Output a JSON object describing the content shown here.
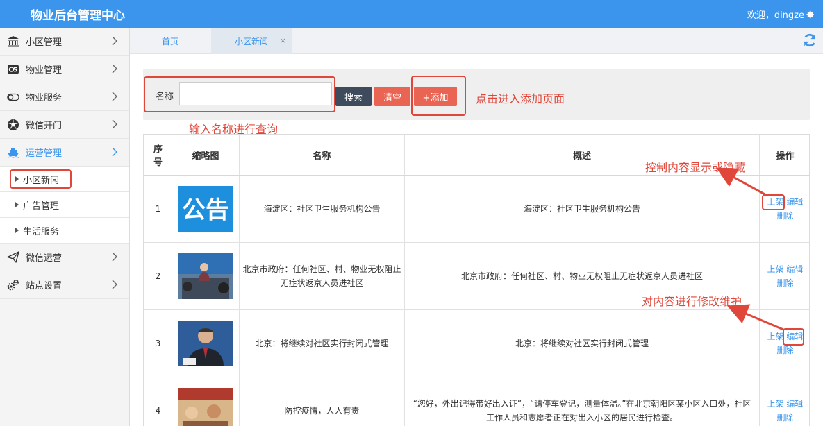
{
  "header": {
    "title": "物业后台管理中心",
    "welcome": "欢迎，dingze"
  },
  "sidebar": {
    "items": [
      {
        "label": "小区管理",
        "icon": "building-icon"
      },
      {
        "label": "物业管理",
        "icon": "os-badge-icon"
      },
      {
        "label": "物业服务",
        "icon": "toggle-icon"
      },
      {
        "label": "微信开门",
        "icon": "football-icon"
      },
      {
        "label": "运营管理",
        "icon": "ship-icon"
      }
    ],
    "subitems": [
      "小区新闻",
      "广告管理",
      "生活服务"
    ],
    "items_after": [
      {
        "label": "微信运营",
        "icon": "paper-plane-icon"
      },
      {
        "label": "站点设置",
        "icon": "gears-icon"
      }
    ]
  },
  "tabs": {
    "home": "首页",
    "news": "小区新闻",
    "close": "×"
  },
  "search": {
    "label": "名称",
    "value": "",
    "search_btn": "搜索",
    "clear_btn": "清空",
    "add_btn": "+添加"
  },
  "notes": {
    "add": "点击进入添加页面",
    "query": "输入名称进行查询",
    "toggle": "控制内容显示或隐藏",
    "edit": "对内容进行修改维护"
  },
  "table": {
    "headers": {
      "index_line1": "序",
      "index_line2": "号",
      "thumb": "缩略图",
      "name": "名称",
      "desc": "概述",
      "ops": "操作"
    },
    "rows": [
      {
        "index": "1",
        "thumb_text": "公告",
        "name": "海淀区：社区卫生服务机构公告",
        "desc": "海淀区：社区卫生服务机构公告",
        "op1": "上架",
        "op2": "编辑",
        "op3": "删除"
      },
      {
        "index": "2",
        "thumb_text": "",
        "name": "北京市政府：任何社区、村、物业无权阻止无症状返京人员进社区",
        "desc": "北京市政府：任何社区、村、物业无权阻止无症状返京人员进社区",
        "op1": "上架",
        "op2": "编辑",
        "op3": "删除"
      },
      {
        "index": "3",
        "thumb_text": "",
        "name": "北京：将继续对社区实行封闭式管理",
        "desc": "北京：将继续对社区实行封闭式管理",
        "op1": "上架",
        "op2": "编辑",
        "op3": "删除"
      },
      {
        "index": "4",
        "thumb_text": "",
        "name": "防控疫情，人人有责",
        "desc": "“您好，外出记得带好出入证”，“请停车登记，测量体温。”在北京朝阳区某小区入口处，社区工作人员和志愿者正在对出入小区的居民进行检查。",
        "op1": "上架",
        "op2": "编辑",
        "op3": "删除"
      }
    ]
  },
  "colors": {
    "primary": "#3b95ec",
    "danger": "#e96452",
    "dark_button": "#3d4b5c",
    "annotation": "#e0463a"
  }
}
